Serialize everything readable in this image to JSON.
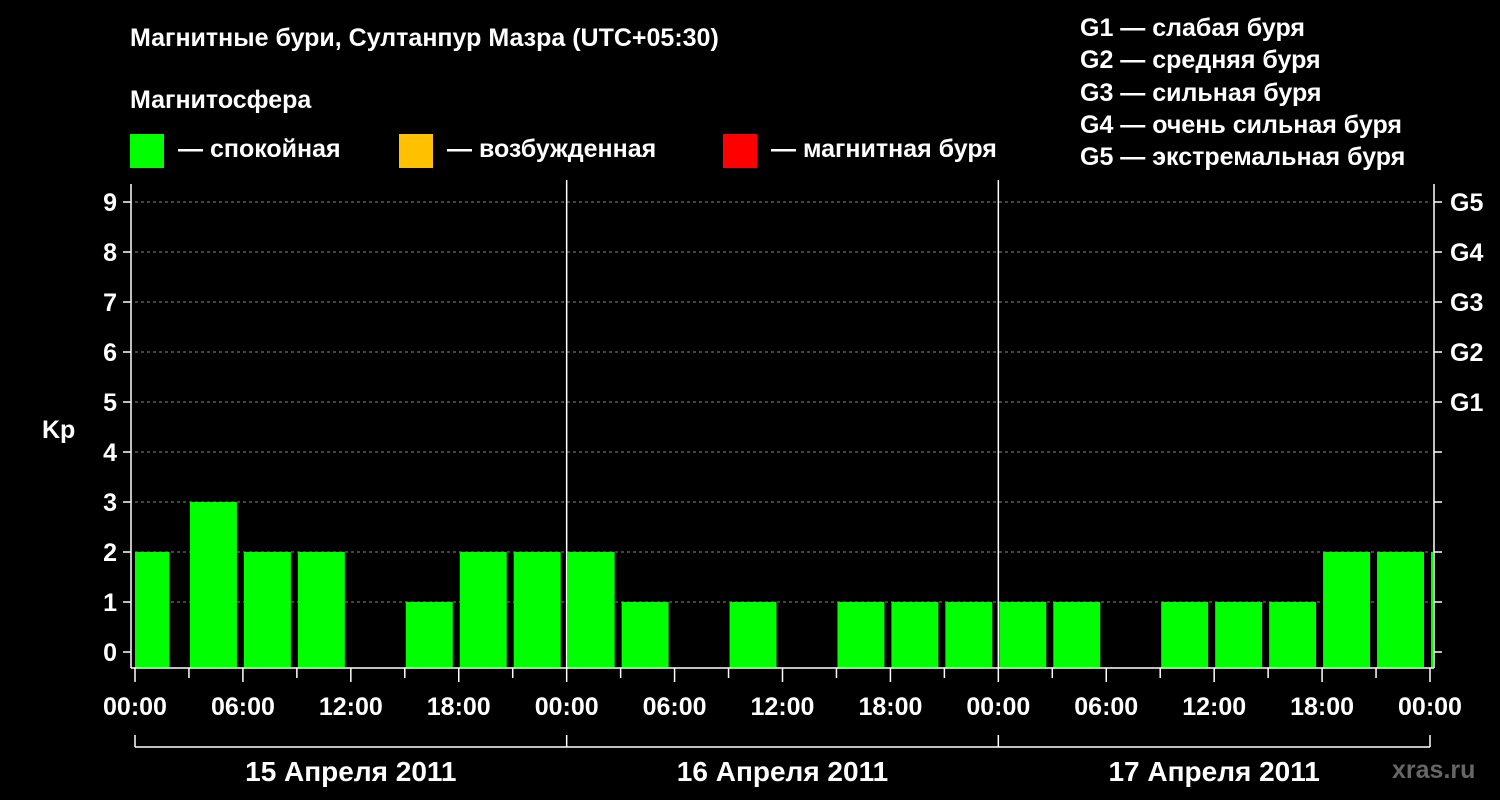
{
  "title": "Магнитные бури, Султанпур Мазра (UTC+05:30)",
  "magnetosphere_label": "Магнитосфера",
  "legend": [
    {
      "label": "— спокойная",
      "color": "#00ff00"
    },
    {
      "label": "— возбужденная",
      "color": "#ffc000"
    },
    {
      "label": "— магнитная буря",
      "color": "#ff0000"
    }
  ],
  "storm_levels": [
    "G1 — слабая буря",
    "G2 — средняя буря",
    "G3 — сильная буря",
    "G4 — очень сильная буря",
    "G5 — экстремальная буря"
  ],
  "watermark": "xras.ru",
  "chart_data": {
    "type": "bar",
    "ylabel": "Kp",
    "ylim": [
      0,
      9
    ],
    "yticks": [
      0,
      1,
      2,
      3,
      4,
      5,
      6,
      7,
      8,
      9
    ],
    "right_axis_labels": [
      {
        "kp": 5,
        "label": "G1"
      },
      {
        "kp": 6,
        "label": "G2"
      },
      {
        "kp": 7,
        "label": "G3"
      },
      {
        "kp": 8,
        "label": "G4"
      },
      {
        "kp": 9,
        "label": "G5"
      }
    ],
    "xtick_labels": [
      "00:00",
      "06:00",
      "12:00",
      "18:00",
      "00:00",
      "06:00",
      "12:00",
      "18:00",
      "00:00",
      "06:00",
      "12:00",
      "18:00",
      "00:00"
    ],
    "days": [
      "15 Апреля 2011",
      "16 Апреля 2011",
      "17 Апреля 2011"
    ],
    "grid": true,
    "legend_position": "top",
    "series": [
      {
        "interval_start_hours": [
          0,
          3,
          6,
          9,
          12,
          15,
          18,
          21,
          24,
          27,
          30,
          33,
          36,
          39,
          42,
          45,
          48,
          51,
          54,
          57,
          60,
          63,
          66,
          69,
          72
        ],
        "interval_end_hours": [
          2.25,
          6,
          9,
          12,
          15,
          18,
          21,
          24,
          27,
          30,
          33,
          36,
          39,
          42,
          45,
          48,
          51,
          54,
          57,
          60,
          63,
          66,
          69,
          72,
          71.8
        ],
        "kp": [
          2,
          3,
          2,
          2,
          0,
          1,
          2,
          2,
          2,
          1,
          0,
          1,
          0,
          1,
          1,
          1,
          1,
          1,
          0,
          1,
          1,
          1,
          2,
          2,
          2
        ]
      }
    ]
  }
}
